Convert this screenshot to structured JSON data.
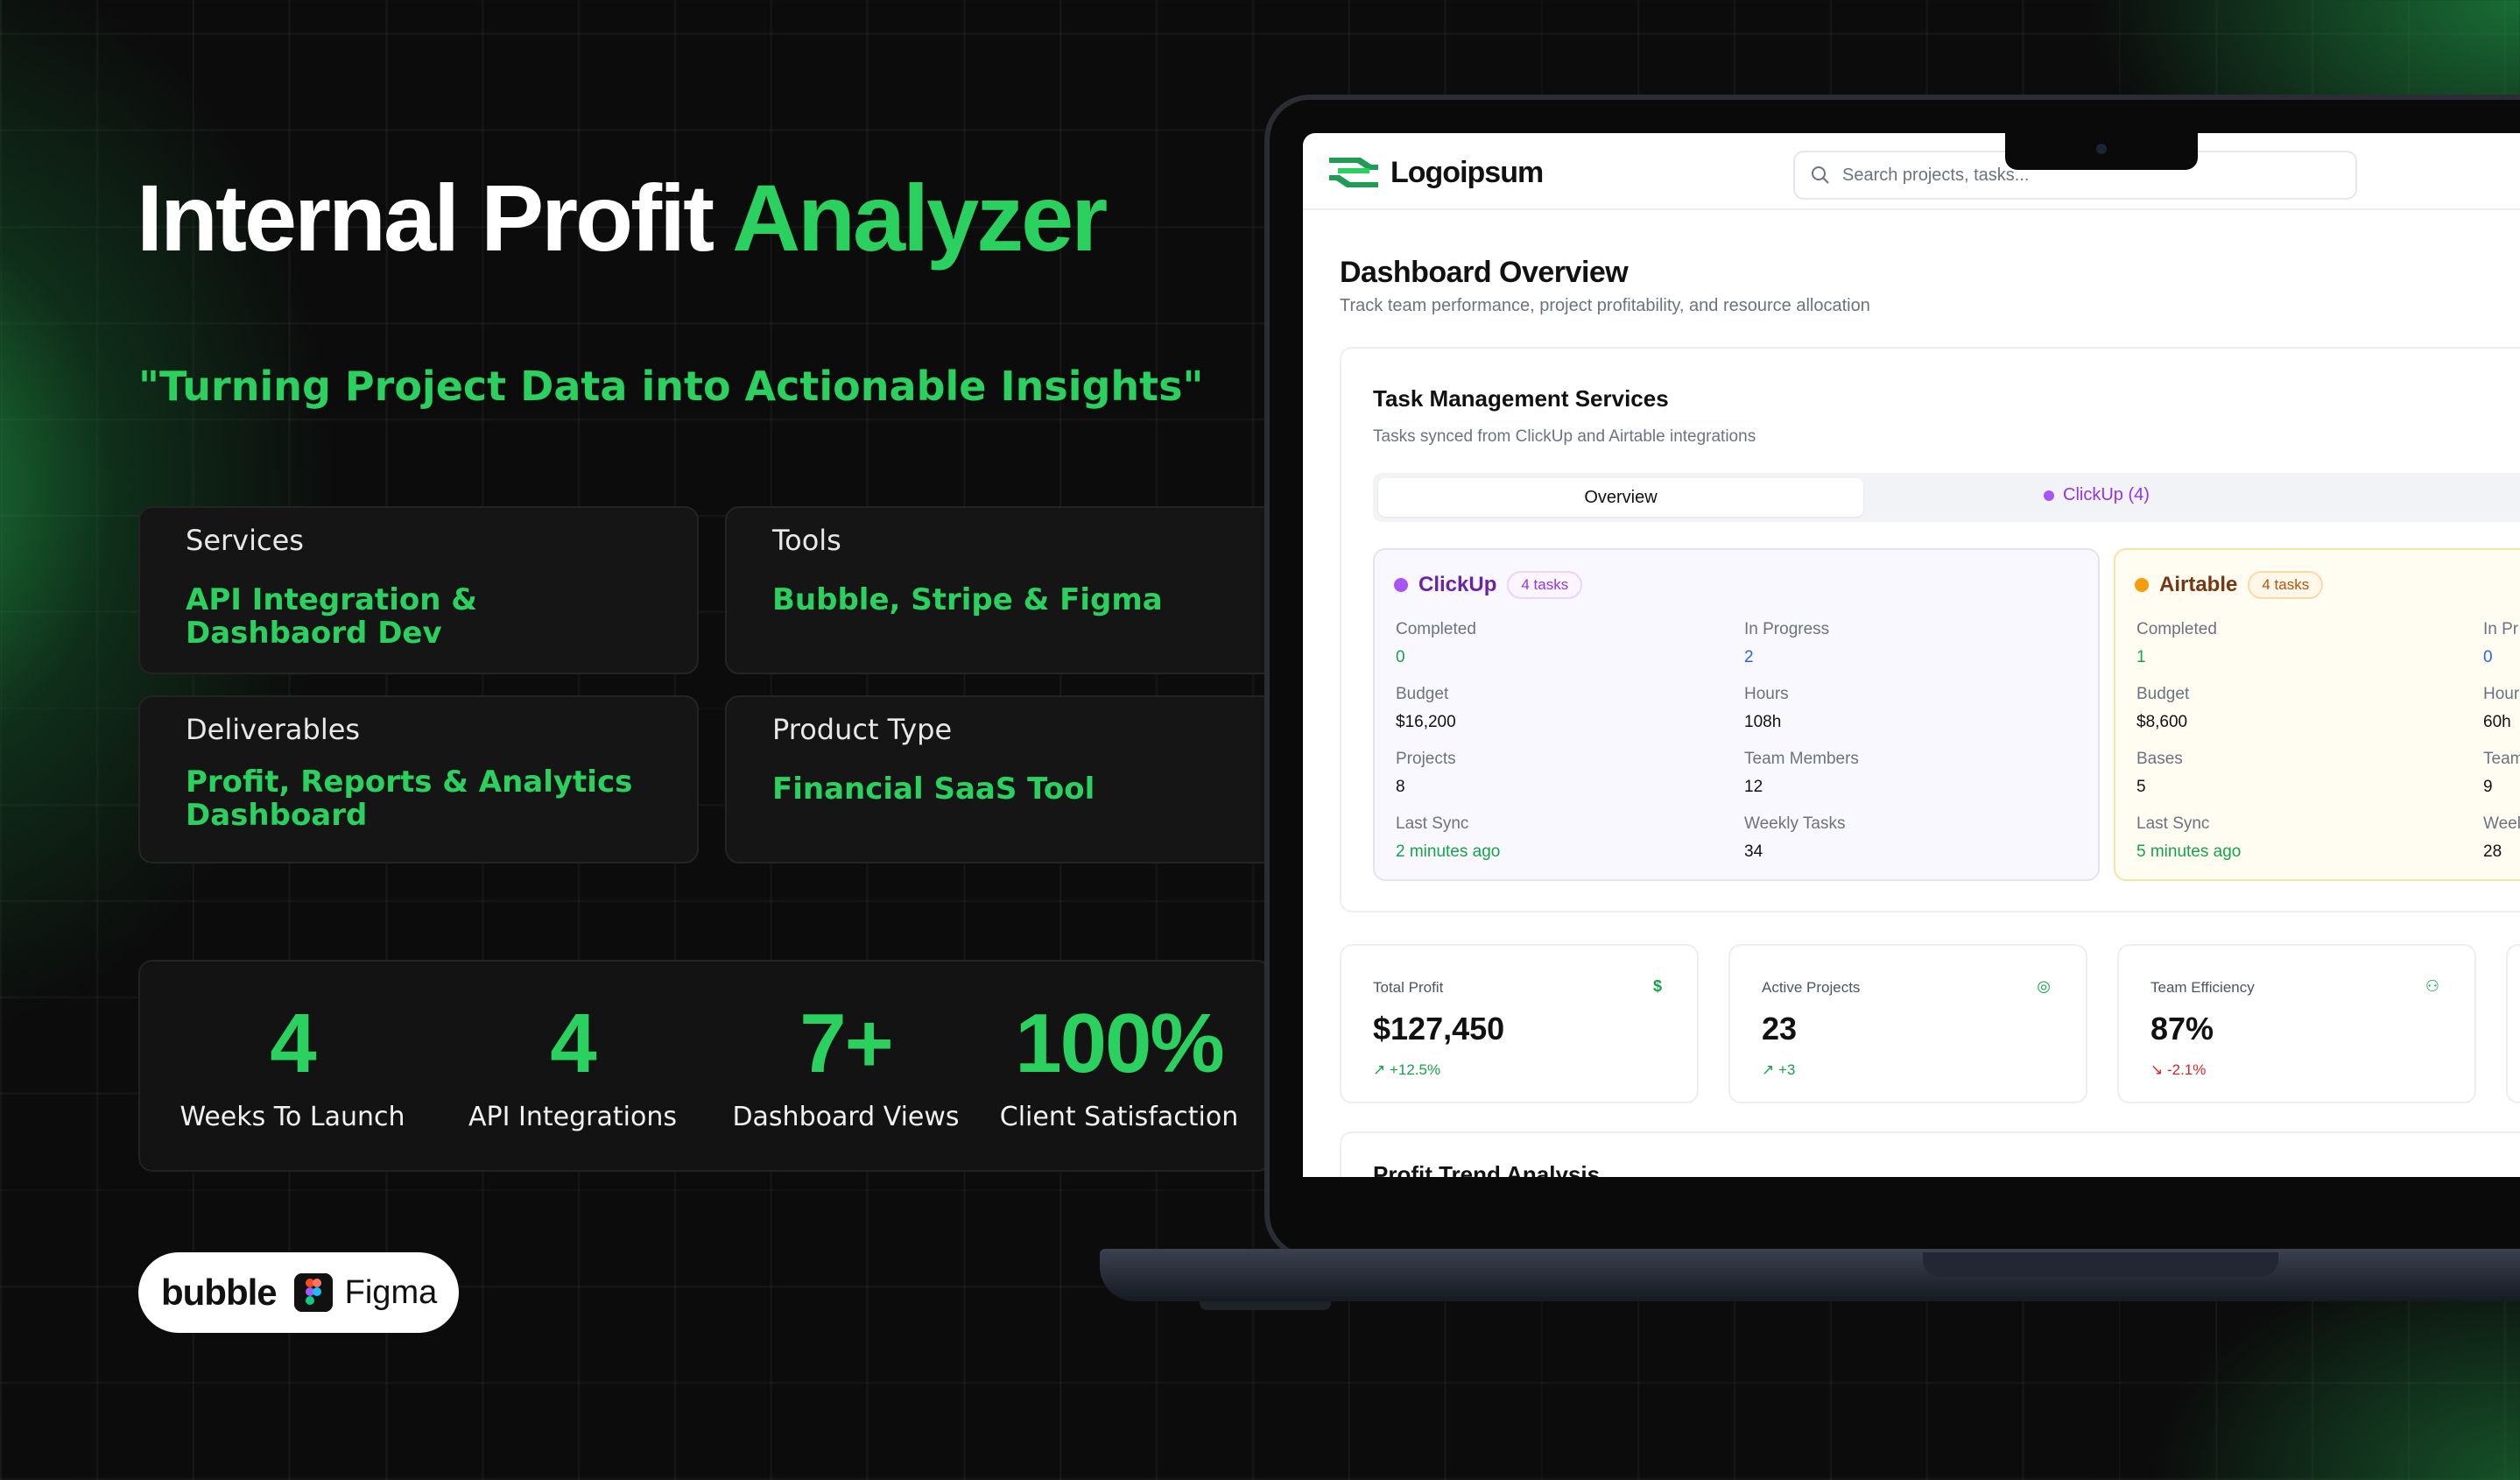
{
  "hero": {
    "title_main": "Internal Profit ",
    "title_accent": "Analyzer",
    "tagline": "\"Turning Project Data into Actionable Insights\""
  },
  "info_cards": {
    "services": {
      "label": "Services",
      "value": "API Integration & Dashbaord Dev"
    },
    "tools": {
      "label": "Tools",
      "value": "Bubble, Stripe & Figma"
    },
    "deliverables": {
      "label": "Deliverables",
      "value_line1": "Profit, Reports & Analytics",
      "value_line2": "Dashboard"
    },
    "product_type": {
      "label": "Product Type",
      "value": "Financial SaaS Tool"
    }
  },
  "stats": [
    {
      "number": "4",
      "caption": "Weeks To Launch"
    },
    {
      "number": "4",
      "caption": "API Integrations"
    },
    {
      "number": "7+",
      "caption": "Dashboard Views"
    },
    {
      "number": "100%",
      "caption": "Client Satisfaction"
    }
  ],
  "tool_logos": {
    "bubble": "bubble",
    "figma": "Figma"
  },
  "colors": {
    "accent": "#2bd15f",
    "background": "#0c0c0c",
    "clickup": "#9333ea",
    "airtable": "#f59e0b"
  },
  "dashboard": {
    "brand": "Logoipsum",
    "search_placeholder": "Search projects, tasks...",
    "title": "Dashboard Overview",
    "subtitle": "Track team performance, project profitability, and resource allocation",
    "panel": {
      "title": "Task Management Services",
      "subtitle": "Tasks synced from ClickUp and Airtable integrations",
      "tab_overview": "Overview",
      "tab_clickup": "ClickUp (4)"
    },
    "clickup": {
      "name": "ClickUp",
      "badge": "4 tasks",
      "completed_label": "Completed",
      "completed": "0",
      "in_progress_label": "In Progress",
      "in_progress": "2",
      "budget_label": "Budget",
      "budget": "$16,200",
      "hours_label": "Hours",
      "hours": "108h",
      "projects_label": "Projects",
      "projects": "8",
      "team_label": "Team Members",
      "team": "12",
      "sync_label": "Last Sync",
      "sync": "2 minutes ago",
      "weekly_label": "Weekly Tasks",
      "weekly": "34"
    },
    "airtable": {
      "name": "Airtable",
      "badge": "4 tasks",
      "completed_label": "Completed",
      "completed": "1",
      "in_progress_label": "In Pr",
      "in_progress": "0",
      "budget_label": "Budget",
      "budget": "$8,600",
      "hours_label": "Hour",
      "hours": "60h",
      "bases_label": "Bases",
      "bases": "5",
      "team_label": "Team",
      "team": "9",
      "sync_label": "Last Sync",
      "sync": "5 minutes ago",
      "weekly_label": "Weel",
      "weekly": "28"
    },
    "metrics": [
      {
        "label": "Total Profit",
        "icon": "$",
        "value": "$127,450",
        "delta": "↗ +12.5%"
      },
      {
        "label": "Active Projects",
        "icon": "◎",
        "value": "23",
        "delta": "↗ +3"
      },
      {
        "label": "Team Efficiency",
        "icon": "⚇",
        "value": "87%",
        "delta": "↘ -2.1%"
      }
    ],
    "bottom_panel_title": "Profit Trend Analysis"
  }
}
